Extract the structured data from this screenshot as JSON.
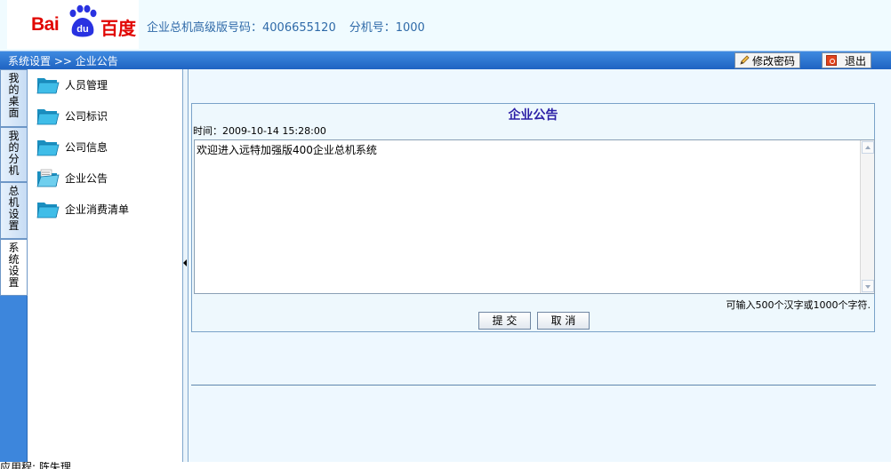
{
  "header": {
    "logo_text": "Bai",
    "logo_paw": "du",
    "logo_cn": "百度",
    "info_label": "企业总机高级版号码：4006655120",
    "ext_label": "分机号：1000"
  },
  "navbar": {
    "breadcrumb": "系统设置 >> 企业公告",
    "change_password_label": "修改密码",
    "exit_label": "退出"
  },
  "vtabs": [
    {
      "label": [
        "我",
        "的",
        "桌",
        "面"
      ],
      "active": false
    },
    {
      "label": [
        "我",
        "的",
        "分",
        "机"
      ],
      "active": false
    },
    {
      "label": [
        "总",
        "机",
        "设",
        "置"
      ],
      "active": false
    },
    {
      "label": [
        "系",
        "统",
        "设",
        "置"
      ],
      "active": true
    }
  ],
  "sidebar": {
    "items": [
      {
        "label": "人员管理"
      },
      {
        "label": "公司标识"
      },
      {
        "label": "公司信息"
      },
      {
        "label": "企业公告"
      },
      {
        "label": "企业消费清单"
      }
    ]
  },
  "panel": {
    "title": "企业公告",
    "time": "时间：2009-10-14 15:28:00",
    "content": "欢迎进入远特加强版400企业总机系统",
    "hint": "可输入500个汉字或1000个字符.",
    "submit_label": "提 交",
    "cancel_label": "取 消"
  },
  "status": {
    "text": "应用程: 阵失理"
  },
  "colors": {
    "brand_red": "#e10602",
    "brand_blue": "#2932e1",
    "nav_blue": "#2b6fd0",
    "title_color": "#2b1fa6"
  }
}
